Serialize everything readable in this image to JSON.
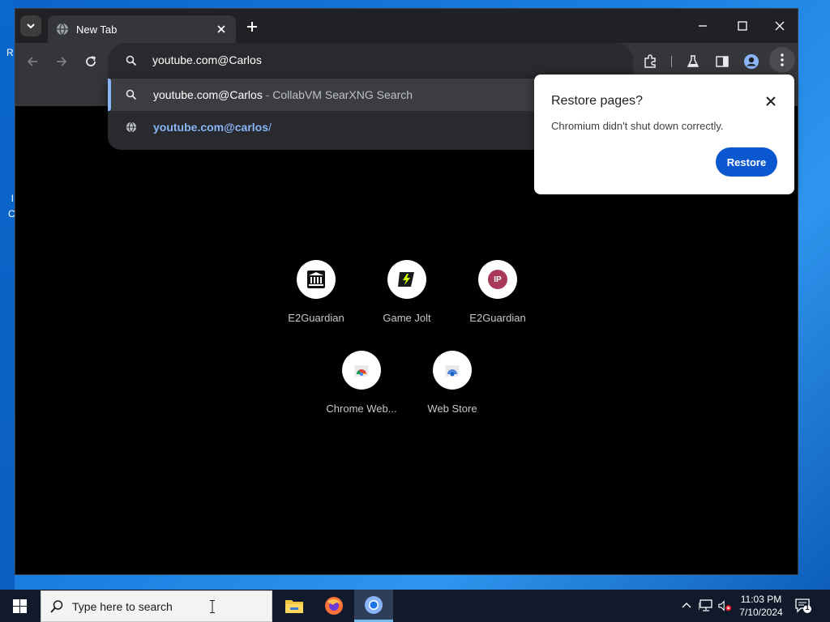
{
  "desktop": {
    "fragments": [
      "R",
      "l",
      "C"
    ]
  },
  "browser": {
    "tab": {
      "title": "New Tab"
    },
    "omnibox": {
      "value": "youtube.com@Carlos"
    },
    "suggestions": [
      {
        "text": "youtube.com@Carlos",
        "separator": " - ",
        "description": "CollabVM SearXNG Search"
      },
      {
        "url_bold": "youtube.com@carlos",
        "url_rest": "/"
      }
    ],
    "restore_popup": {
      "title": "Restore pages?",
      "message": "Chromium didn't shut down correctly.",
      "button_label": "Restore"
    },
    "shortcuts": [
      {
        "label": "E2Guardian",
        "icon": "museum-icon"
      },
      {
        "label": "Game Jolt",
        "icon": "game-jolt-icon"
      },
      {
        "label": "E2Guardian",
        "icon": "ip-badge-icon",
        "badge_text": "IP"
      },
      {
        "label": "Chrome Web...",
        "icon": "chrome-web-store-icon"
      },
      {
        "label": "Web Store",
        "icon": "web-store-icon"
      }
    ]
  },
  "taskbar": {
    "search_placeholder": "Type here to search",
    "clock": {
      "time": "11:03 PM",
      "date": "7/10/2024"
    },
    "notification_count": "1"
  },
  "colors": {
    "accent_blue": "#8ab4f8",
    "restore_button": "#0b57d0",
    "ip_badge": "#a8395a"
  }
}
